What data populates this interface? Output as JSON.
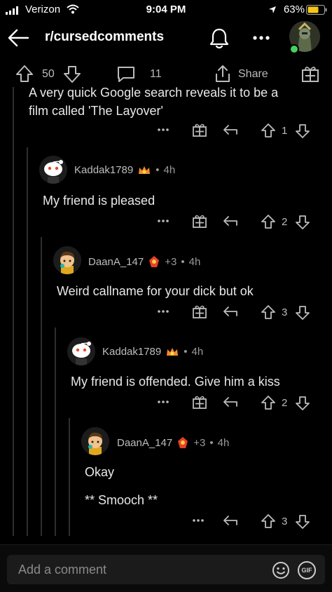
{
  "status_bar": {
    "carrier": "Verizon",
    "time": "9:04 PM",
    "battery": "63%"
  },
  "header": {
    "title": "r/cursedcomments"
  },
  "post_bar": {
    "upvotes": "50",
    "comments": "11",
    "share_label": "Share"
  },
  "comments": [
    {
      "text_lines": [
        "A very quick Google search reveals it to be a",
        "film called 'The Layover'"
      ],
      "votes": "1"
    },
    {
      "username": "Kaddak1789",
      "time": "4h",
      "text": "My friend is pleased",
      "votes": "2"
    },
    {
      "username": "DaanA_147",
      "awards": "+3",
      "time": "4h",
      "text": "Weird callname for your dick but ok",
      "votes": "3"
    },
    {
      "username": "Kaddak1789",
      "time": "4h",
      "text": "My friend is offended. Give him a kiss",
      "votes": "2"
    },
    {
      "username": "DaanA_147",
      "awards": "+3",
      "time": "4h",
      "text_lines": [
        "Okay",
        "** Smooch **"
      ],
      "votes": "3"
    }
  ],
  "comment_input": {
    "placeholder": "Add a comment",
    "gif_label": "GIF"
  },
  "colors": {
    "background": "#000000",
    "text": "#e8e8e8",
    "muted": "#9a9a9a",
    "battery": "#f5c518",
    "online_dot": "#46d160"
  }
}
